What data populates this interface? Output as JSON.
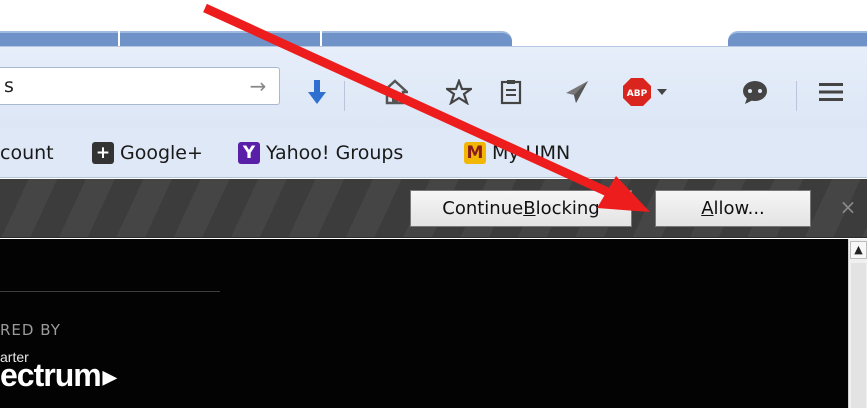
{
  "toolbar": {
    "url_fragment": "s",
    "go_arrow": "→",
    "icons": [
      "download-arrow-icon",
      "home-icon",
      "bookmark-star-icon",
      "reading-list-icon",
      "send-icon",
      "adblock-plus-icon",
      "chat-icon",
      "hamburger-menu-icon"
    ],
    "abp_label": "ABP"
  },
  "bookmarks": {
    "account_partial": "count",
    "google_plus": "Google+",
    "yahoo_groups": "Yahoo! Groups",
    "my_umn": "My UMN",
    "google_plus_icon_glyph": "+",
    "yahoo_icon_glyph": "Y",
    "umn_icon_glyph": "M"
  },
  "notification": {
    "continue_prefix": "Continue ",
    "continue_underlined": "B",
    "continue_suffix": "locking",
    "allow_underlined": "A",
    "allow_suffix": "llow...",
    "close_glyph": "×"
  },
  "content": {
    "powered_by": "RED BY",
    "brand_small": "arter",
    "brand_big": "ectrum",
    "brand_arrow": "▶"
  },
  "scrollbar": {
    "up_arrow": "▲"
  },
  "colors": {
    "annotation_arrow": "#ee1d1d",
    "download_blue": "#2f6fd0",
    "adblock_red": "#d9251d",
    "yahoo_purple": "#5a1fa8",
    "umn_maroon": "#8b1a1a",
    "umn_gold": "#f2b705"
  }
}
